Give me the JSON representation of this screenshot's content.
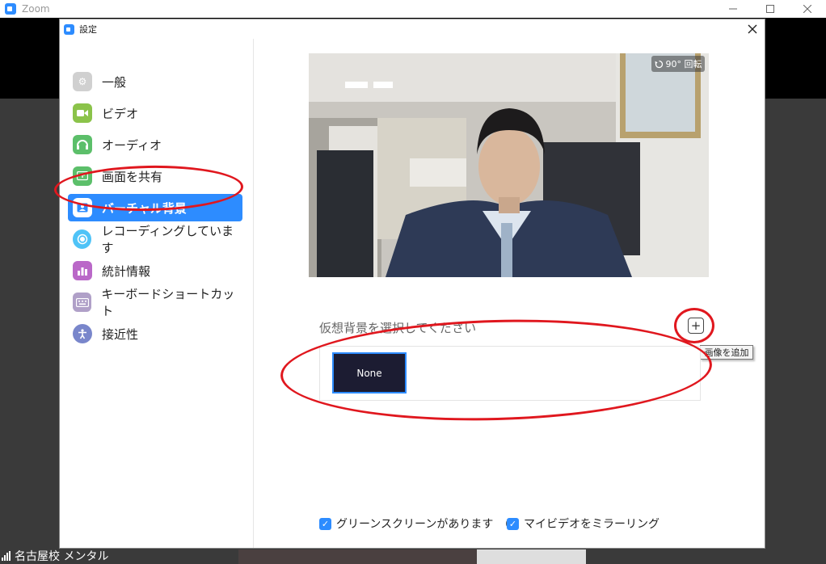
{
  "zoom_window": {
    "title": "Zoom",
    "participant_name": "名古屋校 メンタル"
  },
  "settings": {
    "title": "設定",
    "sidebar": {
      "items": [
        {
          "label": "一般",
          "icon": "gear-icon",
          "color": "#d0d0d0",
          "active": false
        },
        {
          "label": "ビデオ",
          "icon": "video-camera-icon",
          "color": "#8bc34a",
          "active": false
        },
        {
          "label": "オーディオ",
          "icon": "headphones-icon",
          "color": "#5cbf6a",
          "active": false
        },
        {
          "label": "画面を共有",
          "icon": "share-screen-icon",
          "color": "#5cbf6a",
          "active": false
        },
        {
          "label": "バーチャル背景",
          "icon": "virtual-background-icon",
          "color": "#2d8cff",
          "active": true
        },
        {
          "label": "レコーディングしています",
          "icon": "record-icon",
          "color": "#4fc3f7",
          "active": false
        },
        {
          "label": "統計情報",
          "icon": "statistics-icon",
          "color": "#ba68c8",
          "active": false
        },
        {
          "label": "キーボードショートカット",
          "icon": "keyboard-icon",
          "color": "#b0a0c8",
          "active": false
        },
        {
          "label": "接近性",
          "icon": "accessibility-icon",
          "color": "#7986cb",
          "active": false
        }
      ]
    },
    "virtual_background": {
      "rotate_label": "90° 回転",
      "choose_label": "仮想背景を選択してください",
      "add_image_tooltip": "画像を追加",
      "backgrounds": [
        {
          "label": "None",
          "selected": true
        }
      ],
      "green_screen": {
        "label": "グリーンスクリーンがあります",
        "checked": true
      },
      "mirror_video": {
        "label": "マイビデオをミラーリング",
        "checked": true
      }
    }
  },
  "colors": {
    "accent": "#2d8cff",
    "annotation": "#e0171e"
  }
}
